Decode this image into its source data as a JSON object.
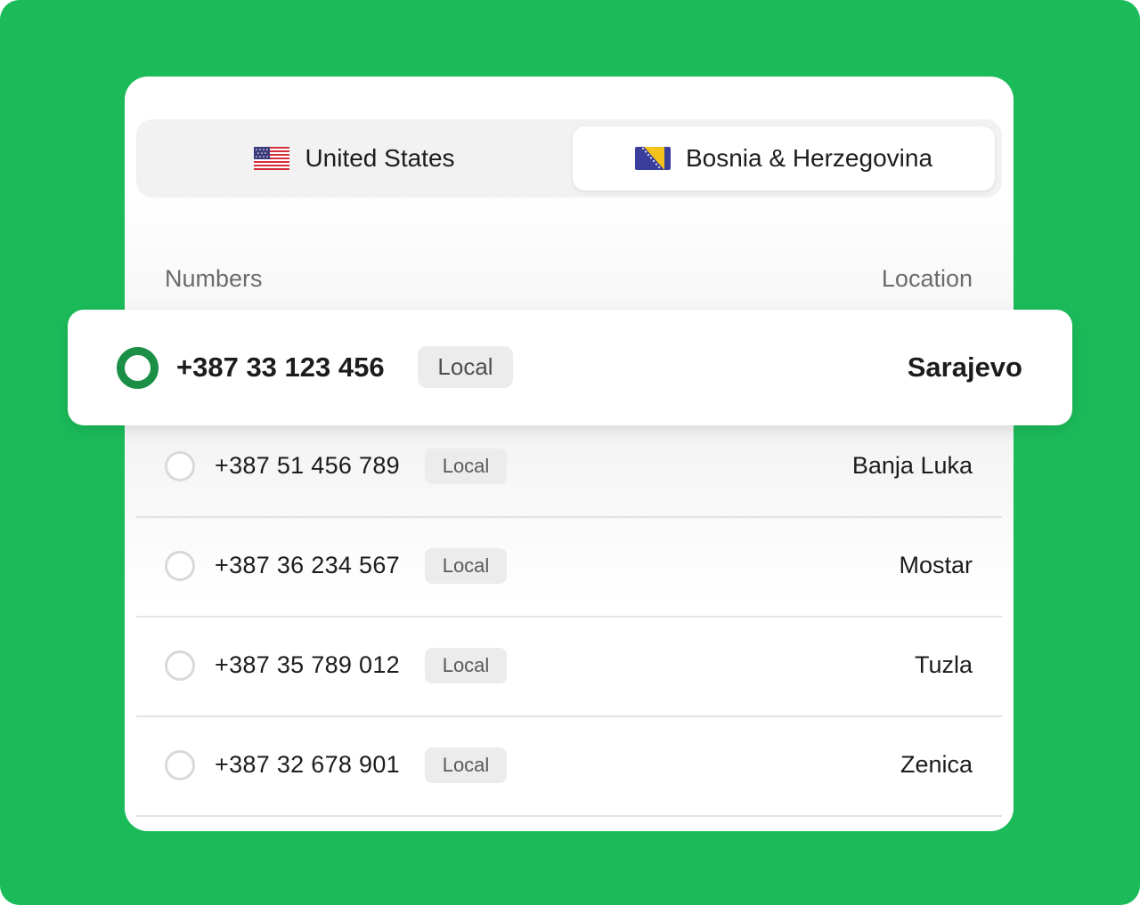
{
  "colors": {
    "background": "#1bbb5a",
    "selected_radio": "#1a8f45",
    "card": "#ffffff"
  },
  "tabs": [
    {
      "label": "United States",
      "icon": "us-flag-icon",
      "active": false
    },
    {
      "label": "Bosnia & Herzegovina",
      "icon": "ba-flag-icon",
      "active": true
    }
  ],
  "table": {
    "headers": {
      "numbers": "Numbers",
      "location": "Location"
    },
    "selected": {
      "number": "+387 33 123 456",
      "type": "Local",
      "location": "Sarajevo"
    },
    "rows": [
      {
        "number": "+387 51 456 789",
        "type": "Local",
        "location": "Banja Luka"
      },
      {
        "number": "+387 36 234 567",
        "type": "Local",
        "location": "Mostar"
      },
      {
        "number": "+387 35 789 012",
        "type": "Local",
        "location": "Tuzla"
      },
      {
        "number": "+387 32 678 901",
        "type": "Local",
        "location": "Zenica"
      }
    ]
  }
}
